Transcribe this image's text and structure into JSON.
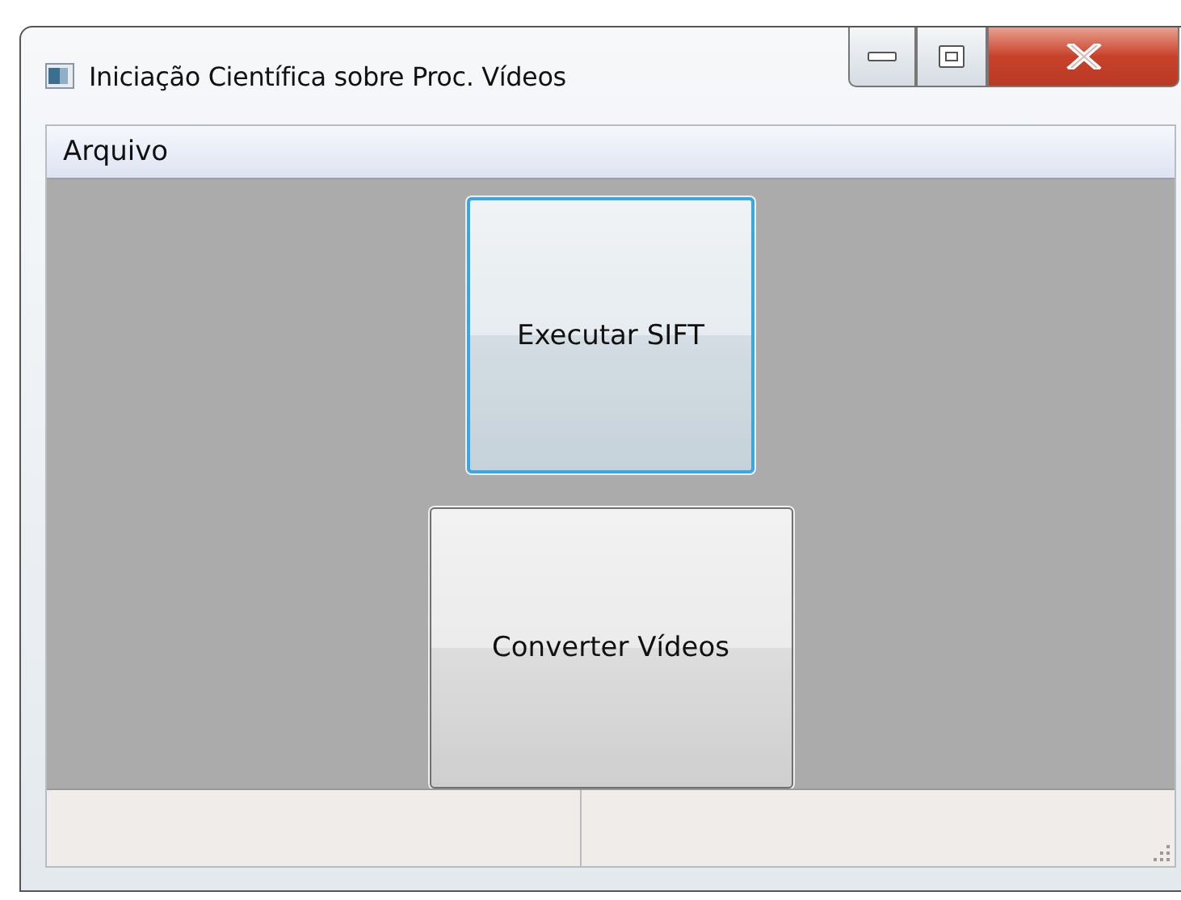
{
  "window": {
    "title": "Iniciação Científica sobre Proc. Vídeos"
  },
  "menu": [
    {
      "label": "Arquivo"
    }
  ],
  "buttons": [
    {
      "label": "Executar SIFT",
      "focused": true
    },
    {
      "label": "Converter Vídeos",
      "focused": false
    }
  ]
}
